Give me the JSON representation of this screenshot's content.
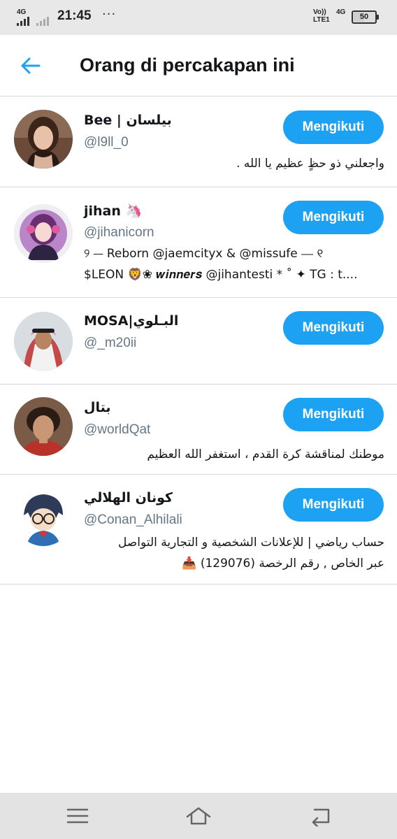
{
  "status_bar": {
    "network_left": "4G",
    "time": "21:45",
    "overflow_dots": "···",
    "volte_line1": "Vo))",
    "volte_line2": "LTE1",
    "network_right": "4G",
    "battery": "50",
    "battery_level": 0.5
  },
  "header": {
    "title": "Orang di percakapan ini"
  },
  "users": [
    {
      "name": "Bee | بيلسان",
      "handle": "@l9ll_0",
      "bio": [
        "واجعلني ذو حظٍ عظيم يا الله ."
      ],
      "bio_rtl": true,
      "button": "Mengikuti"
    },
    {
      "name": "jihan 🦄",
      "handle": "@jihanicorn",
      "bio": [
        "୨ ⎯⎯ Reborn @jaemcityx & @missufe ⎯⎯ ୧",
        "$LEON 🦁❀ 𝒘𝒊𝒏𝒏𝒆𝒓𝒔 @jihantesti * ˚ ✦ TG : t...."
      ],
      "bio_rtl": false,
      "button": "Mengikuti"
    },
    {
      "name": "MOSA|البـلوي",
      "handle": "@_m20ii",
      "bio": [],
      "bio_rtl": false,
      "button": "Mengikuti"
    },
    {
      "name": "بتال",
      "handle": "@worldQat",
      "bio": [
        "موطنك لمناقشة كرة القدم ، استغفر الله العظيم"
      ],
      "bio_rtl": true,
      "button": "Mengikuti"
    },
    {
      "name": "كونان الهلالي",
      "handle": "@Conan_Alhilali",
      "bio": [
        "حساب رياضي | للإعلانات الشخصية و التجارية التواصل",
        "عبر الخاص , رقم الرخصة (129076) 📥"
      ],
      "bio_rtl": true,
      "button": "Mengikuti"
    }
  ],
  "colors": {
    "accent": "#1da1f2",
    "text_primary": "#14171a",
    "text_secondary": "#657786",
    "divider": "#d6d6d6"
  },
  "icons": {
    "back": "arrow-left-icon",
    "nav_menu": "menu-icon",
    "nav_home": "home-icon",
    "nav_back": "back-icon"
  }
}
